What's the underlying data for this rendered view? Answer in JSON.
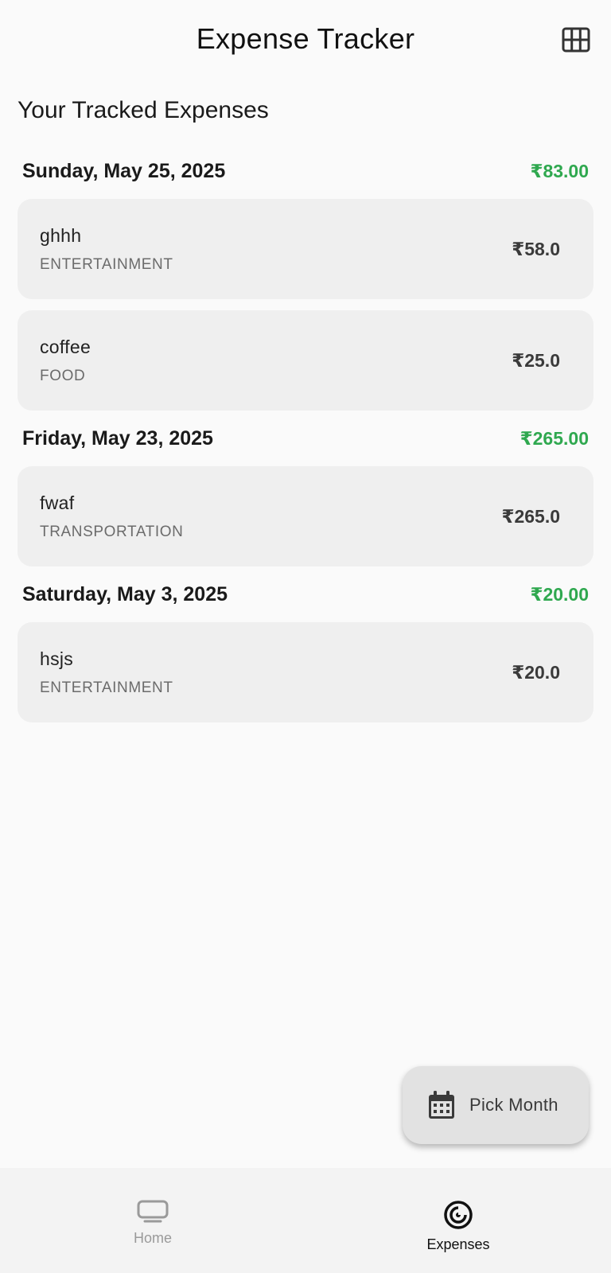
{
  "app_bar": {
    "title": "Expense Tracker",
    "grid_icon": "grid-view-icon"
  },
  "section_title": "Your Tracked Expenses",
  "currency_color": "#2fa84f",
  "days": [
    {
      "date": "Sunday, May 25, 2025",
      "total": "₹83.00",
      "expenses": [
        {
          "title": "ghhh",
          "category": "ENTERTAINMENT",
          "amount": "₹58.0"
        },
        {
          "title": "coffee",
          "category": "FOOD",
          "amount": "₹25.0"
        }
      ]
    },
    {
      "date": "Friday, May 23, 2025",
      "total": "₹265.00",
      "expenses": [
        {
          "title": "fwaf",
          "category": "TRANSPORTATION",
          "amount": "₹265.0"
        }
      ]
    },
    {
      "date": "Saturday, May 3, 2025",
      "total": "₹20.00",
      "expenses": [
        {
          "title": "hsjs",
          "category": "ENTERTAINMENT",
          "amount": "₹20.0"
        }
      ]
    }
  ],
  "fab": {
    "label": "Pick Month",
    "icon": "calendar-icon"
  },
  "bottom_nav": {
    "items": [
      {
        "label": "Home",
        "icon": "tv-icon",
        "active": false
      },
      {
        "label": "Expenses",
        "icon": "target-icon",
        "active": true
      }
    ]
  }
}
